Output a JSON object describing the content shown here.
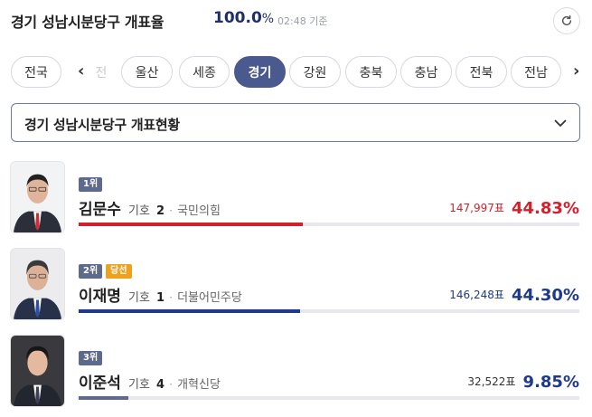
{
  "header": {
    "title": "경기 성남시분당구 개표율",
    "rate": "100.0",
    "rate_unit": "%",
    "time": "02:48 기준",
    "refresh_icon": "refresh-icon"
  },
  "tabs": [
    {
      "label": "전국",
      "active": false
    },
    {
      "label": "전",
      "active": false
    },
    {
      "label": "울산",
      "active": false
    },
    {
      "label": "세종",
      "active": false
    },
    {
      "label": "경기",
      "active": true
    },
    {
      "label": "강원",
      "active": false
    },
    {
      "label": "충북",
      "active": false
    },
    {
      "label": "충남",
      "active": false
    },
    {
      "label": "전북",
      "active": false
    },
    {
      "label": "전남",
      "active": false
    }
  ],
  "district_select": {
    "label": "경기 성남시분당구 개표현황",
    "icon": "chevron-down-icon"
  },
  "candidates": [
    {
      "rank": "1위",
      "elected": "",
      "name": "김문수",
      "gi_label": "기호",
      "number": "2",
      "party": "국민의힘",
      "votes": "147,997표",
      "percent": "44.83%",
      "percent_value": 44.83,
      "color": "#d4202c"
    },
    {
      "rank": "2위",
      "elected": "당선",
      "name": "이재명",
      "gi_label": "기호",
      "number": "1",
      "party": "더불어민주당",
      "votes": "146,248표",
      "percent": "44.30%",
      "percent_value": 44.3,
      "color": "#1f3a8c"
    },
    {
      "rank": "3위",
      "elected": "",
      "name": "이준석",
      "gi_label": "기호",
      "number": "4",
      "party": "개혁신당",
      "votes": "32,522표",
      "percent": "9.85%",
      "percent_value": 9.85,
      "color": "#5e6a8c"
    }
  ]
}
